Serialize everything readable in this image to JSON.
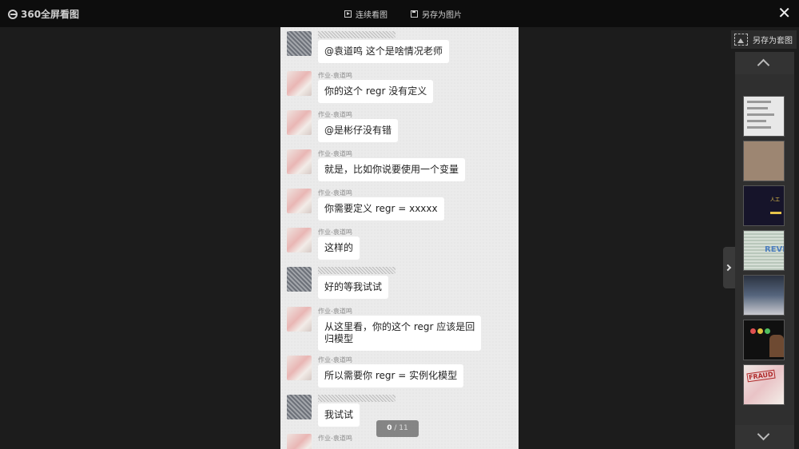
{
  "app": {
    "title": "360全屏看图",
    "slideshow_label": "连续看图",
    "save_image_label": "另存为图片",
    "close_icon": "close-icon"
  },
  "viewer": {
    "messages": [
      {
        "sender": "",
        "avatar": "a",
        "text": "@袁道鸣  这个是啥情况老师"
      },
      {
        "sender": "作业-袁道鸣",
        "avatar": "b",
        "text": "你的这个 regr 没有定义"
      },
      {
        "sender": "作业-袁道鸣",
        "avatar": "b",
        "text": "@是彬仔没有错"
      },
      {
        "sender": "作业-袁道鸣",
        "avatar": "b",
        "text": "就是，比如你说要使用一个变量"
      },
      {
        "sender": "作业-袁道鸣",
        "avatar": "b",
        "text": "你需要定义 regr = xxxxx"
      },
      {
        "sender": "作业-袁道鸣",
        "avatar": "b",
        "text": "这样的"
      },
      {
        "sender": "",
        "avatar": "a",
        "text": "好的等我试试"
      },
      {
        "sender": "作业-袁道鸣",
        "avatar": "b",
        "text": "从这里看，你的这个 regr 应该是回\n归模型"
      },
      {
        "sender": "作业-袁道鸣",
        "avatar": "b",
        "text": "所以需要你 regr = 实例化模型"
      },
      {
        "sender": "",
        "avatar": "a",
        "text": "我试试"
      },
      {
        "sender": "作业-袁道鸣",
        "avatar": "b",
        "text": ""
      }
    ],
    "counter_current": "0",
    "counter_total": "/ 11"
  },
  "sidebar": {
    "save_set_label": "另存为套图",
    "thumb3_text": "人工",
    "thumb4_text": "REVI",
    "thumb7_text": "FRAUD"
  }
}
